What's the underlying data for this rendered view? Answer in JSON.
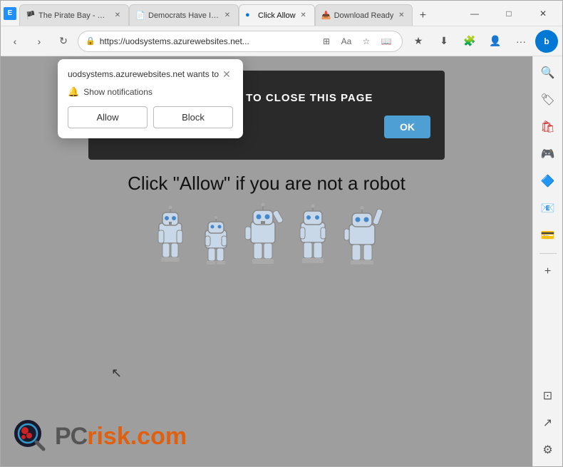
{
  "browser": {
    "tabs": [
      {
        "id": "tab1",
        "title": "The Pirate Bay - Th...",
        "favicon": "🏴",
        "active": false,
        "closeable": true
      },
      {
        "id": "tab2",
        "title": "Democrats Have In...",
        "favicon": "📄",
        "active": false,
        "closeable": true
      },
      {
        "id": "tab3",
        "title": "Click Allow",
        "favicon": "🔵",
        "active": true,
        "closeable": true
      },
      {
        "id": "tab4",
        "title": "Download Ready",
        "favicon": "📥",
        "active": false,
        "closeable": true
      }
    ],
    "new_tab_label": "+",
    "address": "https://uodsystems.azurewebsites.net...",
    "nav": {
      "back": "‹",
      "forward": "›",
      "refresh": "↻",
      "home": "⌂"
    },
    "toolbar": {
      "split_screen": "⊞",
      "collections": "⊡",
      "reader": "Aa",
      "favorites": "☆",
      "reading_list": "📖",
      "favorites2": "★",
      "downloads": "⬇",
      "extensions": "🧩",
      "account": "👤",
      "more": "...",
      "bing": "b"
    },
    "window_controls": {
      "minimize": "—",
      "maximize": "□",
      "close": "✕"
    }
  },
  "right_sidebar": {
    "icons": [
      {
        "name": "search",
        "glyph": "🔍"
      },
      {
        "name": "tag",
        "glyph": "🏷"
      },
      {
        "name": "shopping",
        "glyph": "🛍"
      },
      {
        "name": "games",
        "glyph": "🎮"
      },
      {
        "name": "office",
        "glyph": "🔷"
      },
      {
        "name": "outlook",
        "glyph": "📧"
      },
      {
        "name": "wallet",
        "glyph": "💳"
      },
      {
        "name": "add",
        "glyph": "+"
      },
      {
        "name": "split-bottom",
        "glyph": "⊡"
      },
      {
        "name": "external",
        "glyph": "↗"
      },
      {
        "name": "settings",
        "glyph": "⚙"
      }
    ]
  },
  "popup": {
    "site_text": "uodsystems.azurewebsites.net wants to",
    "close_label": "✕",
    "notification_label": "Show notifications",
    "allow_label": "Allow",
    "block_label": "Block"
  },
  "page": {
    "dark_box_text": "CLICK ALLOW TO CLOSE THIS PAGE",
    "ok_label": "OK",
    "robot_text": "Click \"Allow\"  if you are not   a robot"
  },
  "pcrisk": {
    "pc_text": "PC",
    "risk_text": "risk.com"
  }
}
